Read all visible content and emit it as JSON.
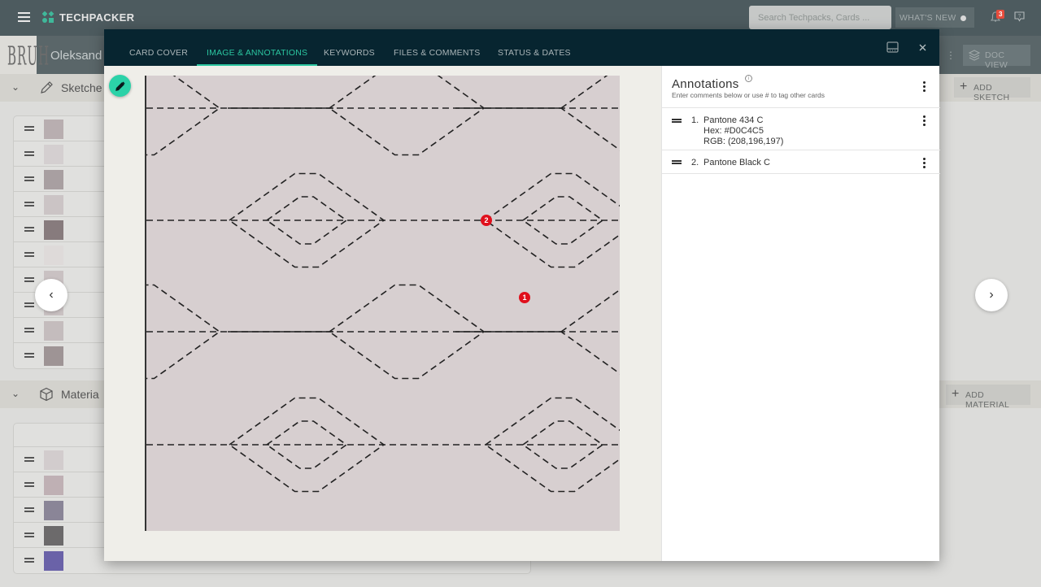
{
  "app": {
    "brand": "TECHPACKER",
    "search_placeholder": "Search Techpacks, Cards ...",
    "whats_new_label": "WHAT'S NEW",
    "notification_count": "3",
    "techpack_name": "Oleksand",
    "brand_logo_text": "BRUH",
    "doc_view_label": "DOC VIEW"
  },
  "sections": {
    "sketches": {
      "title": "Sketche",
      "add_label": "ADD SKETCH",
      "rows": 10
    },
    "materials": {
      "title": "Materia",
      "add_label": "ADD MATERIAL",
      "rows": 5
    }
  },
  "modal": {
    "tabs": [
      {
        "label": "CARD COVER",
        "active": false
      },
      {
        "label": "IMAGE & ANNOTATIONS",
        "active": true
      },
      {
        "label": "KEYWORDS",
        "active": false
      },
      {
        "label": "FILES & COMMENTS",
        "active": false
      },
      {
        "label": "STATUS & DATES",
        "active": false
      }
    ],
    "markers": [
      {
        "label": "1"
      },
      {
        "label": "2"
      }
    ],
    "annotations": {
      "title": "Annotations",
      "subtitle": "Enter comments below or use # to tag other cards",
      "items": [
        {
          "number": "1.",
          "lines": [
            "Pantone 434 C",
            "Hex: #D0C4C5",
            "RGB: (208,196,197)"
          ]
        },
        {
          "number": "2.",
          "lines": [
            "Pantone Black C"
          ]
        }
      ]
    }
  },
  "colors": {
    "accent": "#2bc6a0",
    "modal_header": "#072530",
    "marker": "#e0101c",
    "fabric": "#d7cfd0"
  }
}
